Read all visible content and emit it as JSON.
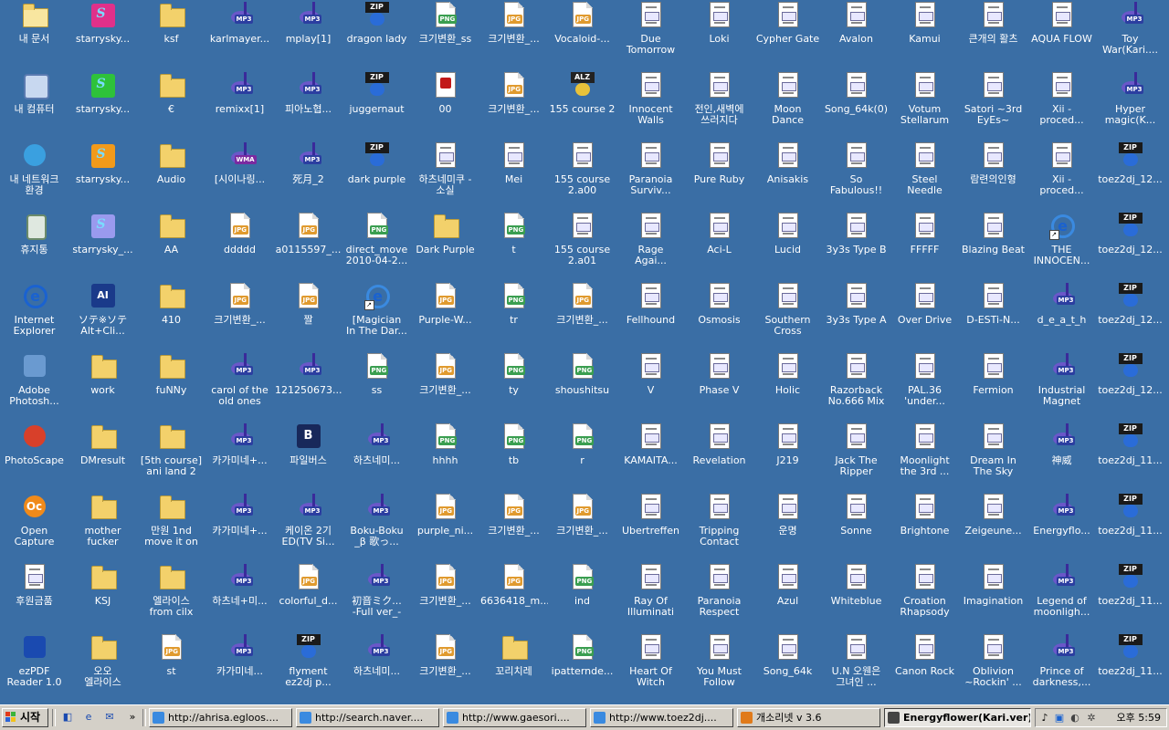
{
  "taskbar": {
    "start_label": "시작",
    "quicklaunch_more": "»",
    "tasks": [
      {
        "label": "http://ahrisa.egloos....",
        "icon": "ie-icon",
        "active": false
      },
      {
        "label": "http://search.naver....",
        "icon": "ie-icon",
        "active": false
      },
      {
        "label": "http://www.gaesori....",
        "icon": "ie-icon",
        "active": false
      },
      {
        "label": "http://www.toez2dj....",
        "icon": "ie-icon",
        "active": false
      },
      {
        "label": "개소리넷 v 3.6",
        "icon": "app-icon",
        "active": false
      },
      {
        "label": "Energyflower(Kari.ver)",
        "icon": "music-player-icon",
        "active": true
      }
    ],
    "clock": "오후 5:59"
  },
  "columns": [
    [
      {
        "label": "내 문서",
        "icon": "my-documents-icon"
      },
      {
        "label": "내 컴퓨터",
        "icon": "my-computer-icon"
      },
      {
        "label": "내 네트워크\n환경",
        "icon": "network-icon"
      },
      {
        "label": "휴지통",
        "icon": "recycle-bin-icon"
      },
      {
        "label": "Internet\nExplorer",
        "icon": "internet-explorer-icon"
      },
      {
        "label": "Adobe\nPhotosh...",
        "icon": "photoshop-icon"
      },
      {
        "label": "PhotoScape",
        "icon": "photoscape-icon"
      },
      {
        "label": "Open\nCapture",
        "icon": "opencapture-icon"
      },
      {
        "label": "후원금품",
        "icon": "document-icon"
      },
      {
        "label": "ezPDF\nReader 1.0",
        "icon": "ezpdf-icon"
      }
    ],
    [
      {
        "label": "starrysky...",
        "icon": "starrysky-icon",
        "v": "pk"
      },
      {
        "label": "starrysky...",
        "icon": "starrysky-icon",
        "v": "gr"
      },
      {
        "label": "starrysky...",
        "icon": "starrysky-icon",
        "v": "or"
      },
      {
        "label": "starrysky_...",
        "icon": "starrysky-icon",
        "v": "lv"
      },
      {
        "label": "ソテ※ソテ\nAlt+Cli...",
        "icon": "app-icon"
      },
      {
        "label": "work",
        "icon": "folder-icon"
      },
      {
        "label": "DMresult",
        "icon": "folder-icon"
      },
      {
        "label": "mother\nfucker",
        "icon": "folder-icon"
      },
      {
        "label": "KSJ",
        "icon": "folder-icon"
      },
      {
        "label": "오오\n엘라이스",
        "icon": "folder-icon"
      }
    ],
    [
      {
        "label": "ksf",
        "icon": "folder-icon"
      },
      {
        "label": "€",
        "icon": "folder-icon"
      },
      {
        "label": "Audio",
        "icon": "folder-icon"
      },
      {
        "label": "AA",
        "icon": "folder-icon"
      },
      {
        "label": "410",
        "icon": "folder-icon"
      },
      {
        "label": "fuNNy",
        "icon": "folder-icon"
      },
      {
        "label": "[5th course]\nani land 2",
        "icon": "folder-icon"
      },
      {
        "label": "만원 1nd\nmove it on",
        "icon": "folder-icon"
      },
      {
        "label": "엘라이스\nfrom cilx",
        "icon": "folder-icon"
      },
      {
        "label": "st",
        "icon": "jpg-file-icon"
      }
    ],
    [
      {
        "label": "karlmayer...",
        "icon": "mp3-file-icon"
      },
      {
        "label": "remixx[1]",
        "icon": "mp3-file-icon"
      },
      {
        "label": "[시이나링...",
        "icon": "wma-file-icon"
      },
      {
        "label": "ddddd",
        "icon": "jpg-file-icon"
      },
      {
        "label": "크기변환_...",
        "icon": "jpg-file-icon"
      },
      {
        "label": "carol of the\nold ones",
        "icon": "mp3-file-icon"
      },
      {
        "label": "카가미네+...",
        "icon": "mp3-file-icon"
      },
      {
        "label": "카가미네+...",
        "icon": "mp3-file-icon"
      },
      {
        "label": "하츠네+미...",
        "icon": "mp3-file-icon"
      },
      {
        "label": "카가미네...",
        "icon": "mp3-file-icon"
      }
    ],
    [
      {
        "label": "mplay[1]",
        "icon": "mp3-file-icon"
      },
      {
        "label": "피아노협...",
        "icon": "mp3-file-icon"
      },
      {
        "label": "死月_2",
        "icon": "mp3-file-icon"
      },
      {
        "label": "a0115597_...",
        "icon": "jpg-file-icon"
      },
      {
        "label": "짤",
        "icon": "jpg-file-icon"
      },
      {
        "label": "121250673...",
        "icon": "mp3-file-icon"
      },
      {
        "label": "파일버스",
        "icon": "filebus-icon"
      },
      {
        "label": "케이온 2기\nED(TV Si...",
        "icon": "mp3-file-icon"
      },
      {
        "label": "colorful_d...",
        "icon": "jpg-file-icon"
      },
      {
        "label": "flyment\nez2dj p...",
        "icon": "zip-file-icon"
      }
    ],
    [
      {
        "label": "dragon lady",
        "icon": "zip-file-icon"
      },
      {
        "label": "juggernaut",
        "icon": "zip-file-icon"
      },
      {
        "label": "dark purple",
        "icon": "zip-file-icon"
      },
      {
        "label": "direct_move\n2010-04-2...",
        "icon": "png-file-icon"
      },
      {
        "label": "[Magician\nIn The Dar...",
        "icon": "internet-shortcut-icon"
      },
      {
        "label": "ss",
        "icon": "png-file-icon"
      },
      {
        "label": "하츠네미...",
        "icon": "mp3-file-icon"
      },
      {
        "label": "Boku-Boku\n_β 歌っ...",
        "icon": "mp3-file-icon"
      },
      {
        "label": "初音ミク...\n-Full ver_-",
        "icon": "mp3-file-icon"
      },
      {
        "label": "하츠네미...",
        "icon": "mp3-file-icon"
      }
    ],
    [
      {
        "label": "크기변환_ss",
        "icon": "png-file-icon"
      },
      {
        "label": "00",
        "icon": "pdf-file-icon"
      },
      {
        "label": "하츠네미쿠 -\n소실",
        "icon": "document-icon"
      },
      {
        "label": "Dark Purple",
        "icon": "folder-icon"
      },
      {
        "label": "Purple-W...",
        "icon": "jpg-file-icon"
      },
      {
        "label": "크기변환_...",
        "icon": "jpg-file-icon"
      },
      {
        "label": "hhhh",
        "icon": "png-file-icon"
      },
      {
        "label": "purple_ni...",
        "icon": "jpg-file-icon"
      },
      {
        "label": "크기변환_...",
        "icon": "jpg-file-icon"
      },
      {
        "label": "크기변환_...",
        "icon": "jpg-file-icon"
      }
    ],
    [
      {
        "label": "크기변환_...",
        "icon": "jpg-file-icon"
      },
      {
        "label": "크기변환_...",
        "icon": "jpg-file-icon"
      },
      {
        "label": "Mei",
        "icon": "document-icon"
      },
      {
        "label": "t",
        "icon": "png-file-icon"
      },
      {
        "label": "tr",
        "icon": "png-file-icon"
      },
      {
        "label": "ty",
        "icon": "png-file-icon"
      },
      {
        "label": "tb",
        "icon": "png-file-icon"
      },
      {
        "label": "크기변환_...",
        "icon": "jpg-file-icon"
      },
      {
        "label": "6636418_m...",
        "icon": "jpg-file-icon"
      },
      {
        "label": "꼬리치레",
        "icon": "folder-icon"
      }
    ],
    [
      {
        "label": "Vocaloid-...",
        "icon": "jpg-file-icon"
      },
      {
        "label": "155 course 2",
        "icon": "alz-file-icon"
      },
      {
        "label": "155 course\n2.a00",
        "icon": "document-icon"
      },
      {
        "label": "155 course\n2.a01",
        "icon": "document-icon"
      },
      {
        "label": "크기변환_...",
        "icon": "jpg-file-icon"
      },
      {
        "label": "shoushitsu",
        "icon": "png-file-icon"
      },
      {
        "label": "r",
        "icon": "png-file-icon"
      },
      {
        "label": "크기변환_...",
        "icon": "jpg-file-icon"
      },
      {
        "label": "ind",
        "icon": "png-file-icon"
      },
      {
        "label": "ipatternde...",
        "icon": "png-file-icon"
      }
    ],
    [
      {
        "label": "Due\nTomorrow",
        "icon": "stepmania-file-icon"
      },
      {
        "label": "Innocent\nWalls",
        "icon": "stepmania-file-icon"
      },
      {
        "label": "Paranoia\nSurviv...",
        "icon": "stepmania-file-icon"
      },
      {
        "label": "Rage\nAgai...",
        "icon": "stepmania-file-icon"
      },
      {
        "label": "Fellhound",
        "icon": "stepmania-file-icon"
      },
      {
        "label": "V",
        "icon": "stepmania-file-icon"
      },
      {
        "label": "KAMAITA...",
        "icon": "stepmania-file-icon"
      },
      {
        "label": "Ubertreffen",
        "icon": "stepmania-file-icon"
      },
      {
        "label": "Ray Of\nIlluminati",
        "icon": "stepmania-file-icon"
      },
      {
        "label": "Heart Of\nWitch",
        "icon": "stepmania-file-icon"
      }
    ],
    [
      {
        "label": "Loki",
        "icon": "stepmania-file-icon"
      },
      {
        "label": "전인,새벽에\n쓰러지다",
        "icon": "stepmania-file-icon"
      },
      {
        "label": "Pure Ruby",
        "icon": "stepmania-file-icon"
      },
      {
        "label": "Aci-L",
        "icon": "stepmania-file-icon"
      },
      {
        "label": "Osmosis",
        "icon": "stepmania-file-icon"
      },
      {
        "label": "Phase V",
        "icon": "stepmania-file-icon"
      },
      {
        "label": "Revelation",
        "icon": "stepmania-file-icon"
      },
      {
        "label": "Tripping\nContact",
        "icon": "stepmania-file-icon"
      },
      {
        "label": "Paranoia\nRespect",
        "icon": "stepmania-file-icon"
      },
      {
        "label": "You Must\nFollow",
        "icon": "stepmania-file-icon"
      }
    ],
    [
      {
        "label": "Cypher Gate",
        "icon": "stepmania-file-icon"
      },
      {
        "label": "Moon\nDance",
        "icon": "stepmania-file-icon"
      },
      {
        "label": "Anisakis",
        "icon": "stepmania-file-icon"
      },
      {
        "label": "Lucid",
        "icon": "stepmania-file-icon"
      },
      {
        "label": "Southern\nCross",
        "icon": "stepmania-file-icon"
      },
      {
        "label": "Holic",
        "icon": "stepmania-file-icon"
      },
      {
        "label": "J219",
        "icon": "stepmania-file-icon"
      },
      {
        "label": "운명",
        "icon": "stepmania-file-icon"
      },
      {
        "label": "Azul",
        "icon": "stepmania-file-icon"
      },
      {
        "label": "Song_64k",
        "icon": "stepmania-file-icon"
      }
    ],
    [
      {
        "label": "Avalon",
        "icon": "stepmania-file-icon"
      },
      {
        "label": "Song_64k(0)",
        "icon": "stepmania-file-icon"
      },
      {
        "label": "So\nFabulous!!",
        "icon": "stepmania-file-icon"
      },
      {
        "label": "3y3s Type B",
        "icon": "stepmania-file-icon"
      },
      {
        "label": "3y3s Type A",
        "icon": "stepmania-file-icon"
      },
      {
        "label": "Razorback\nNo.666 Mix",
        "icon": "stepmania-file-icon"
      },
      {
        "label": "Jack The\nRipper",
        "icon": "stepmania-file-icon"
      },
      {
        "label": "Sonne",
        "icon": "stepmania-file-icon"
      },
      {
        "label": "Whiteblue",
        "icon": "stepmania-file-icon"
      },
      {
        "label": "U.N 오웬은\n그녀인 ...",
        "icon": "stepmania-file-icon"
      }
    ],
    [
      {
        "label": "Kamui",
        "icon": "stepmania-file-icon"
      },
      {
        "label": "Votum\nStellarum",
        "icon": "stepmania-file-icon"
      },
      {
        "label": "Steel\nNeedle",
        "icon": "stepmania-file-icon"
      },
      {
        "label": "FFFFF",
        "icon": "stepmania-file-icon"
      },
      {
        "label": "Over Drive",
        "icon": "stepmania-file-icon"
      },
      {
        "label": "PAL.36\n'under...",
        "icon": "stepmania-file-icon"
      },
      {
        "label": "Moonlight\nthe 3rd ...",
        "icon": "stepmania-file-icon"
      },
      {
        "label": "Brightone",
        "icon": "stepmania-file-icon"
      },
      {
        "label": "Croation\nRhapsody",
        "icon": "stepmania-file-icon"
      },
      {
        "label": "Canon Rock",
        "icon": "stepmania-file-icon"
      }
    ],
    [
      {
        "label": "큰개의 활츠",
        "icon": "stepmania-file-icon"
      },
      {
        "label": "Satori ~3rd\nEyEs~",
        "icon": "stepmania-file-icon"
      },
      {
        "label": "람련의인형",
        "icon": "stepmania-file-icon"
      },
      {
        "label": "Blazing Beat",
        "icon": "stepmania-file-icon"
      },
      {
        "label": "D-ESTi-N...",
        "icon": "stepmania-file-icon"
      },
      {
        "label": "Fermion",
        "icon": "stepmania-file-icon"
      },
      {
        "label": "Dream In\nThe Sky",
        "icon": "stepmania-file-icon"
      },
      {
        "label": "Zeigeune...",
        "icon": "stepmania-file-icon"
      },
      {
        "label": "Imagination",
        "icon": "stepmania-file-icon"
      },
      {
        "label": "Oblivion\n~Rockin' ...",
        "icon": "stepmania-file-icon"
      }
    ],
    [
      {
        "label": "AQUA FLOW",
        "icon": "stepmania-file-icon"
      },
      {
        "label": "Xii -\nproced...",
        "icon": "stepmania-file-icon"
      },
      {
        "label": "Xii -\nproced...",
        "icon": "stepmania-file-icon"
      },
      {
        "label": "THE\nINNOCEN...",
        "icon": "internet-shortcut-icon"
      },
      {
        "label": "d_e_a_t_h",
        "icon": "mp3-file-icon"
      },
      {
        "label": "Industrial\nMagnet",
        "icon": "mp3-file-icon"
      },
      {
        "label": "神威",
        "icon": "mp3-file-icon"
      },
      {
        "label": "Energyflo...",
        "icon": "mp3-file-icon"
      },
      {
        "label": "Legend of\nmoonligh...",
        "icon": "mp3-file-icon"
      },
      {
        "label": "Prince of\ndarkness,...",
        "icon": "mp3-file-icon"
      }
    ],
    [
      {
        "label": "Toy\nWar(Kari....",
        "icon": "mp3-file-icon"
      },
      {
        "label": "Hyper\nmagic(K...",
        "icon": "mp3-file-icon"
      },
      {
        "label": "toez2dj_12...",
        "icon": "zip-file-icon"
      },
      {
        "label": "toez2dj_12...",
        "icon": "zip-file-icon"
      },
      {
        "label": "toez2dj_12...",
        "icon": "zip-file-icon"
      },
      {
        "label": "toez2dj_12...",
        "icon": "zip-file-icon"
      },
      {
        "label": "toez2dj_11...",
        "icon": "zip-file-icon"
      },
      {
        "label": "toez2dj_11...",
        "icon": "zip-file-icon"
      },
      {
        "label": "toez2dj_11...",
        "icon": "zip-file-icon"
      },
      {
        "label": "toez2dj_11...",
        "icon": "zip-file-icon"
      }
    ]
  ]
}
